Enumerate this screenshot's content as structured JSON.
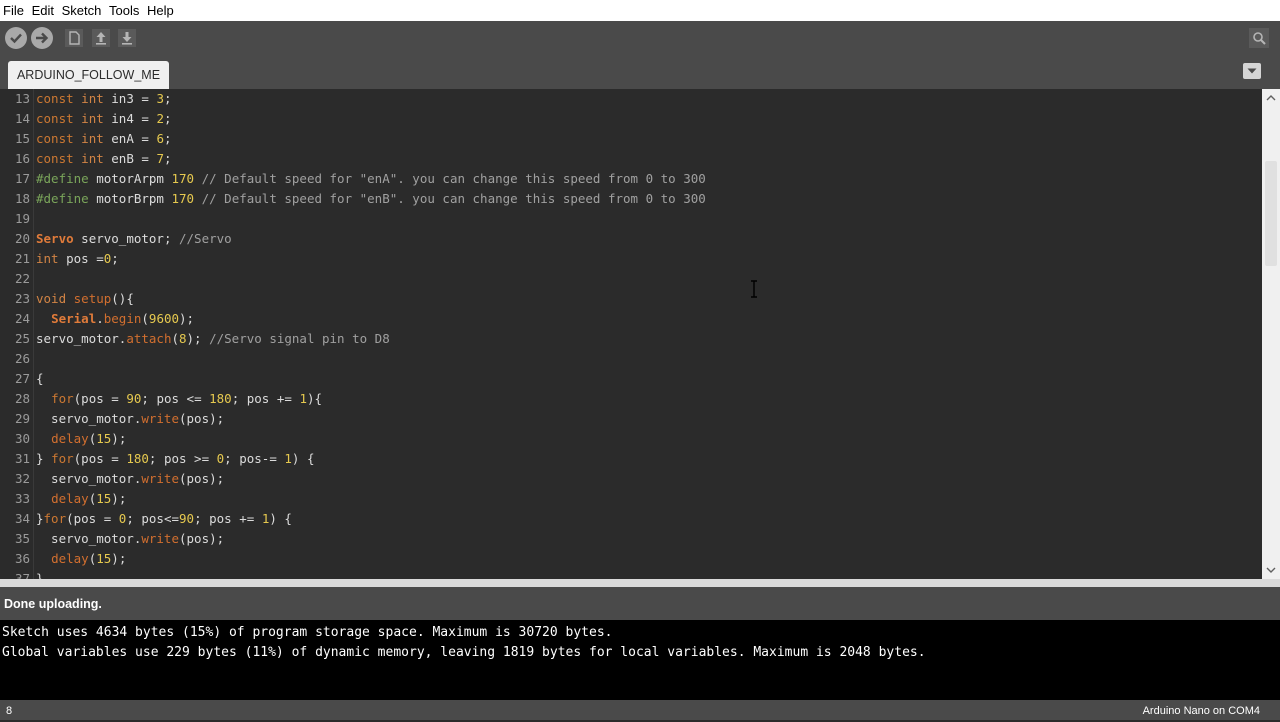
{
  "menu": [
    "File",
    "Edit",
    "Sketch",
    "Tools",
    "Help"
  ],
  "toolbar": {
    "buttons": [
      "verify-icon",
      "upload-icon",
      "new-icon",
      "open-icon",
      "save-icon"
    ],
    "serial_monitor": "serial-monitor-icon"
  },
  "tabs": [
    {
      "label": "ARDUINO_FOLLOW_ME"
    }
  ],
  "editor": {
    "lines": [
      {
        "n": "13",
        "t": [
          [
            "kw",
            "const"
          ],
          [
            "c",
            " "
          ],
          [
            "kw2",
            "int"
          ],
          [
            "c",
            " in3 = "
          ],
          [
            "num",
            "3"
          ],
          [
            "c",
            ";"
          ]
        ]
      },
      {
        "n": "14",
        "t": [
          [
            "kw",
            "const"
          ],
          [
            "c",
            " "
          ],
          [
            "kw2",
            "int"
          ],
          [
            "c",
            " in4 = "
          ],
          [
            "num",
            "2"
          ],
          [
            "c",
            ";"
          ]
        ]
      },
      {
        "n": "15",
        "t": [
          [
            "kw",
            "const"
          ],
          [
            "c",
            " "
          ],
          [
            "kw2",
            "int"
          ],
          [
            "c",
            " enA = "
          ],
          [
            "num",
            "6"
          ],
          [
            "c",
            ";"
          ]
        ]
      },
      {
        "n": "16",
        "t": [
          [
            "kw",
            "const"
          ],
          [
            "c",
            " "
          ],
          [
            "kw2",
            "int"
          ],
          [
            "c",
            " enB = "
          ],
          [
            "num",
            "7"
          ],
          [
            "c",
            ";"
          ]
        ]
      },
      {
        "n": "17",
        "t": [
          [
            "pp",
            "#define"
          ],
          [
            "c",
            " motorArpm "
          ],
          [
            "num",
            "170"
          ],
          [
            "c",
            " "
          ],
          [
            "cm",
            "// Default speed for \"enA\". you can change this speed from 0 to 300"
          ]
        ]
      },
      {
        "n": "18",
        "t": [
          [
            "pp",
            "#define"
          ],
          [
            "c",
            " motorBrpm "
          ],
          [
            "num",
            "170"
          ],
          [
            "c",
            " "
          ],
          [
            "cm",
            "// Default speed for \"enB\". you can change this speed from 0 to 300"
          ]
        ]
      },
      {
        "n": "19",
        "t": []
      },
      {
        "n": "20",
        "t": [
          [
            "cls",
            "Servo"
          ],
          [
            "c",
            " servo_motor; "
          ],
          [
            "cm",
            "//Servo"
          ]
        ]
      },
      {
        "n": "21",
        "t": [
          [
            "kw2",
            "int"
          ],
          [
            "c",
            " pos ="
          ],
          [
            "num",
            "0"
          ],
          [
            "c",
            ";"
          ]
        ]
      },
      {
        "n": "22",
        "t": []
      },
      {
        "n": "23",
        "t": [
          [
            "kw2",
            "void"
          ],
          [
            "c",
            " "
          ],
          [
            "fn",
            "setup"
          ],
          [
            "c",
            "(){"
          ]
        ]
      },
      {
        "n": "24",
        "t": [
          [
            "c",
            "  "
          ],
          [
            "cls",
            "Serial"
          ],
          [
            "c",
            "."
          ],
          [
            "fn",
            "begin"
          ],
          [
            "c",
            "("
          ],
          [
            "num",
            "9600"
          ],
          [
            "c",
            ");"
          ]
        ]
      },
      {
        "n": "25",
        "t": [
          [
            "c",
            "servo_motor."
          ],
          [
            "fn",
            "attach"
          ],
          [
            "c",
            "("
          ],
          [
            "num",
            "8"
          ],
          [
            "c",
            "); "
          ],
          [
            "cm",
            "//Servo signal pin to D8"
          ]
        ]
      },
      {
        "n": "26",
        "t": []
      },
      {
        "n": "27",
        "t": [
          [
            "c",
            "{"
          ]
        ]
      },
      {
        "n": "28",
        "t": [
          [
            "c",
            "  "
          ],
          [
            "kw",
            "for"
          ],
          [
            "c",
            "(pos = "
          ],
          [
            "num",
            "90"
          ],
          [
            "c",
            "; pos <= "
          ],
          [
            "num",
            "180"
          ],
          [
            "c",
            "; pos += "
          ],
          [
            "num",
            "1"
          ],
          [
            "c",
            "){"
          ]
        ]
      },
      {
        "n": "29",
        "t": [
          [
            "c",
            "  servo_motor."
          ],
          [
            "fn",
            "write"
          ],
          [
            "c",
            "(pos);"
          ]
        ]
      },
      {
        "n": "30",
        "t": [
          [
            "c",
            "  "
          ],
          [
            "fn",
            "delay"
          ],
          [
            "c",
            "("
          ],
          [
            "num",
            "15"
          ],
          [
            "c",
            ");"
          ]
        ]
      },
      {
        "n": "31",
        "t": [
          [
            "c",
            "} "
          ],
          [
            "kw",
            "for"
          ],
          [
            "c",
            "(pos = "
          ],
          [
            "num",
            "180"
          ],
          [
            "c",
            "; pos >= "
          ],
          [
            "num",
            "0"
          ],
          [
            "c",
            "; pos-= "
          ],
          [
            "num",
            "1"
          ],
          [
            "c",
            ") {"
          ]
        ]
      },
      {
        "n": "32",
        "t": [
          [
            "c",
            "  servo_motor."
          ],
          [
            "fn",
            "write"
          ],
          [
            "c",
            "(pos);"
          ]
        ]
      },
      {
        "n": "33",
        "t": [
          [
            "c",
            "  "
          ],
          [
            "fn",
            "delay"
          ],
          [
            "c",
            "("
          ],
          [
            "num",
            "15"
          ],
          [
            "c",
            ");"
          ]
        ]
      },
      {
        "n": "34",
        "t": [
          [
            "c",
            "}"
          ],
          [
            "kw",
            "for"
          ],
          [
            "c",
            "(pos = "
          ],
          [
            "num",
            "0"
          ],
          [
            "c",
            "; pos<="
          ],
          [
            "num",
            "90"
          ],
          [
            "c",
            "; pos += "
          ],
          [
            "num",
            "1"
          ],
          [
            "c",
            ") {"
          ]
        ]
      },
      {
        "n": "35",
        "t": [
          [
            "c",
            "  servo_motor."
          ],
          [
            "fn",
            "write"
          ],
          [
            "c",
            "(pos);"
          ]
        ]
      },
      {
        "n": "36",
        "t": [
          [
            "c",
            "  "
          ],
          [
            "fn",
            "delay"
          ],
          [
            "c",
            "("
          ],
          [
            "num",
            "15"
          ],
          [
            "c",
            ");"
          ]
        ]
      },
      {
        "n": "37",
        "t": [
          [
            "c",
            "}"
          ]
        ]
      }
    ]
  },
  "status": {
    "message": "Done uploading."
  },
  "console": {
    "lines": [
      "Sketch uses 4634 bytes (15%) of program storage space. Maximum is 30720 bytes.",
      "Global variables use 229 bytes (11%) of dynamic memory, leaving 1819 bytes for local variables. Maximum is 2048 bytes."
    ]
  },
  "footer": {
    "line": "8",
    "board": "Arduino Nano on COM4"
  },
  "colors": {
    "accent": "#00979c",
    "toolbar": "#4a4a4a",
    "editor_bg": "#2b2b2b"
  }
}
